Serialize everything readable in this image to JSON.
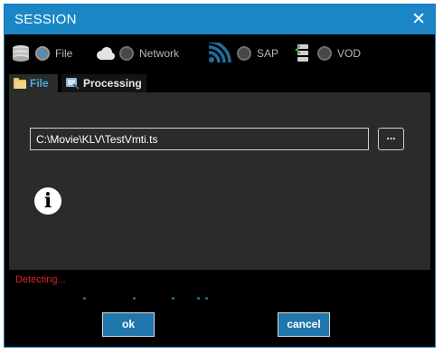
{
  "window": {
    "title": "SESSION",
    "close_glyph": "✕"
  },
  "sources": [
    {
      "id": "file",
      "label": "File",
      "icon": "database-icon",
      "selected": true
    },
    {
      "id": "network",
      "label": "Network",
      "icon": "cloud-icon",
      "selected": false
    },
    {
      "id": "sap",
      "label": "SAP",
      "icon": "wifi-signal-icon",
      "selected": false
    },
    {
      "id": "vod",
      "label": "VOD",
      "icon": "server-stack-icon",
      "selected": false
    }
  ],
  "tabs": [
    {
      "label": "File",
      "icon": "folder-icon",
      "active": true
    },
    {
      "label": "Processing",
      "icon": "processing-icon",
      "active": false
    }
  ],
  "file_panel": {
    "path_value": "C:\\Movie\\KLV\\TestVmti.ts",
    "browse_label": "...",
    "info_glyph": "i"
  },
  "status": {
    "text": "Detecting..."
  },
  "buttons": {
    "ok": "ok",
    "cancel": "cancel"
  },
  "colors": {
    "accent": "#1b86c6",
    "status": "#e02121",
    "active_tab": "#4fa7e0"
  }
}
